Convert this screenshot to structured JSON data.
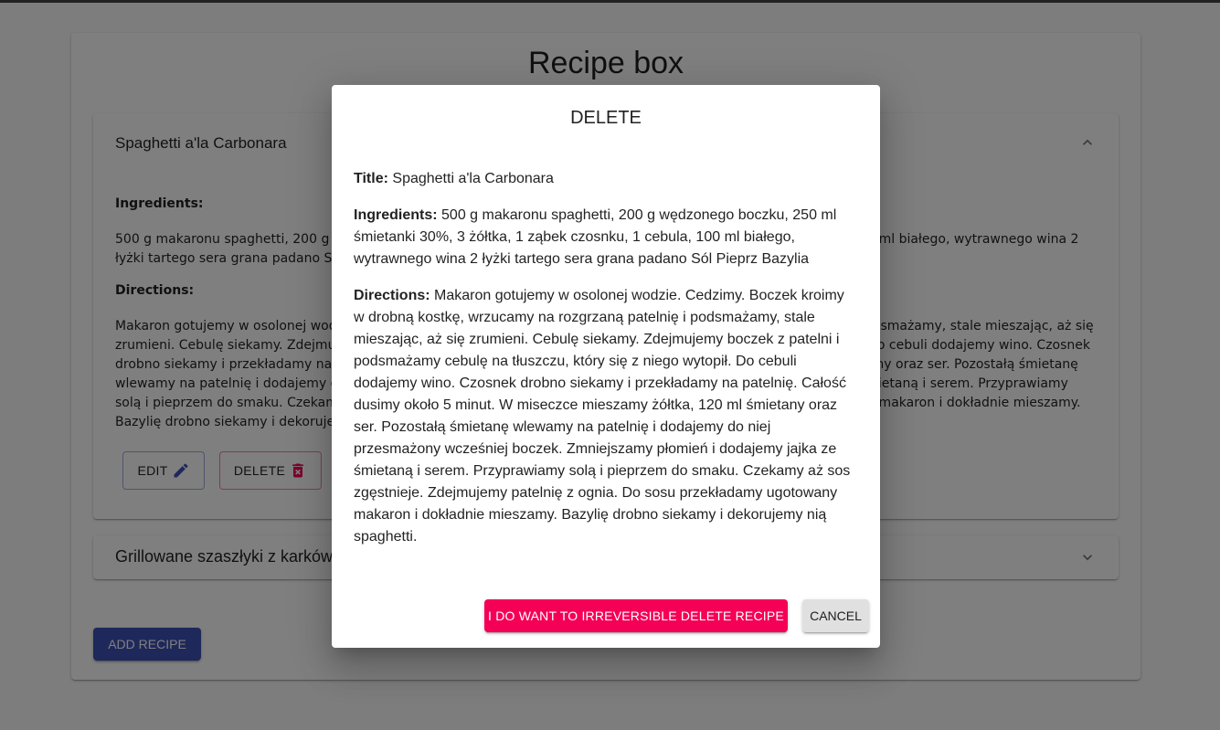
{
  "app": {
    "title": "Recipe box",
    "add_button_label": "ADD RECIPE"
  },
  "recipes": [
    {
      "title": "Spaghetti a'la Carbonara",
      "expanded": true,
      "ingredients_label": "Ingredients:",
      "ingredients": "500 g makaronu spaghetti, 200 g wędzonego boczku, 250 ml śmietanki 30%, 3 żółtka, 1 ząbek czosnku, 1 cebula, 100 ml białego, wytrawnego wina 2 łyżki tartego sera grana padano Sól Pieprz Bazylia",
      "directions_label": "Directions:",
      "directions": "Makaron gotujemy w osolonej wodzie. Cedzimy. Boczek kroimy w drobną kostkę, wrzucamy na rozgrzaną patelnię i podsmażamy, stale mieszając, aż się zrumieni. Cebulę siekamy. Zdejmujemy boczek z patelni i podsmażamy cebulę na tłuszczu, który się z niego wytopił. Do cebuli dodajemy wino. Czosnek drobno siekamy i przekładamy na patelnię. Całość dusimy około 5 minut. W miseczce mieszamy żółtka, 120 ml śmietany oraz ser. Pozostałą śmietanę wlewamy na patelnię i dodajemy do niej przesmażony wcześniej boczek. Zmniejszamy płomień i dodajemy jajka ze śmietaną i serem. Przyprawiamy solą i pieprzem do smaku. Czekamy aż sos zgęstnieje. Zdejmujemy patelnię z ognia. Do sosu przekładamy ugotowany makaron i dokładnie mieszamy. Bazylię drobno siekamy i dekorujemy nią spaghetti.",
      "edit_label": "EDIT",
      "delete_label": "DELETE"
    },
    {
      "title": "Grillowane szaszłyki z karkówki",
      "expanded": false
    }
  ],
  "dialog": {
    "title": "DELETE",
    "title_label": "Title:",
    "title_value": "Spaghetti a'la Carbonara",
    "ingredients_label": "Ingredients:",
    "ingredients_value": "500 g makaronu spaghetti, 200 g wędzonego boczku, 250 ml śmietanki 30%, 3 żółtka, 1 ząbek czosnku, 1 cebula, 100 ml białego, wytrawnego wina 2 łyżki tartego sera grana padano Sól Pieprz Bazylia",
    "directions_label": "Directions:",
    "directions_value": "Makaron gotujemy w osolonej wodzie. Cedzimy. Boczek kroimy w drobną kostkę, wrzucamy na rozgrzaną patelnię i podsmażamy, stale mieszając, aż się zrumieni. Cebulę siekamy. Zdejmujemy boczek z patelni i podsmażamy cebulę na tłuszczu, który się z niego wytopił. Do cebuli dodajemy wino. Czosnek drobno siekamy i przekładamy na patelnię. Całość dusimy około 5 minut. W miseczce mieszamy żółtka, 120 ml śmietany oraz ser. Pozostałą śmietanę wlewamy na patelnię i dodajemy do niej przesmażony wcześniej boczek. Zmniejszamy płomień i dodajemy jajka ze śmietaną i serem. Przyprawiamy solą i pieprzem do smaku. Czekamy aż sos zgęstnieje. Zdejmujemy patelnię z ognia. Do sosu przekładamy ugotowany makaron i dokładnie mieszamy. Bazylię drobno siekamy i dekorujemy nią spaghetti.",
    "confirm_label": "I DO WANT TO IRREVERSIBLE DELETE RECIPE",
    "cancel_label": "CANCEL"
  },
  "icons": {
    "edit": "pencil-icon",
    "delete": "trash-icon",
    "collapse": "chevron-up-icon",
    "expand": "chevron-down-icon"
  },
  "colors": {
    "primary": "#3f51b5",
    "secondary": "#f50057",
    "cancel_bg": "#e0e0e0"
  }
}
